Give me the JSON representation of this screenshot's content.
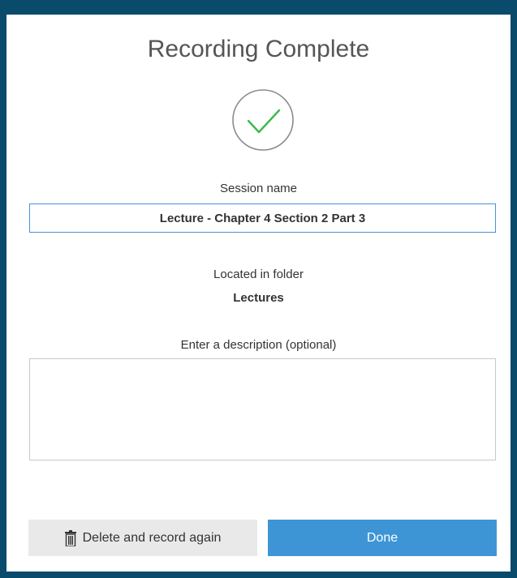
{
  "dialog": {
    "title": "Recording Complete",
    "session_name_label": "Session name",
    "session_name_value": "Lecture - Chapter 4 Section 2 Part 3",
    "folder_label": "Located in folder",
    "folder_name": "Lectures",
    "description_label": "Enter a description (optional)",
    "description_value": ""
  },
  "buttons": {
    "delete_label": "Delete and record again",
    "done_label": "Done"
  },
  "colors": {
    "accent": "#3e95d5",
    "check_green": "#3cb94a",
    "window_frame": "#0a4a6b"
  },
  "icons": {
    "success": "checkmark-circle-icon",
    "delete": "trash-icon"
  }
}
